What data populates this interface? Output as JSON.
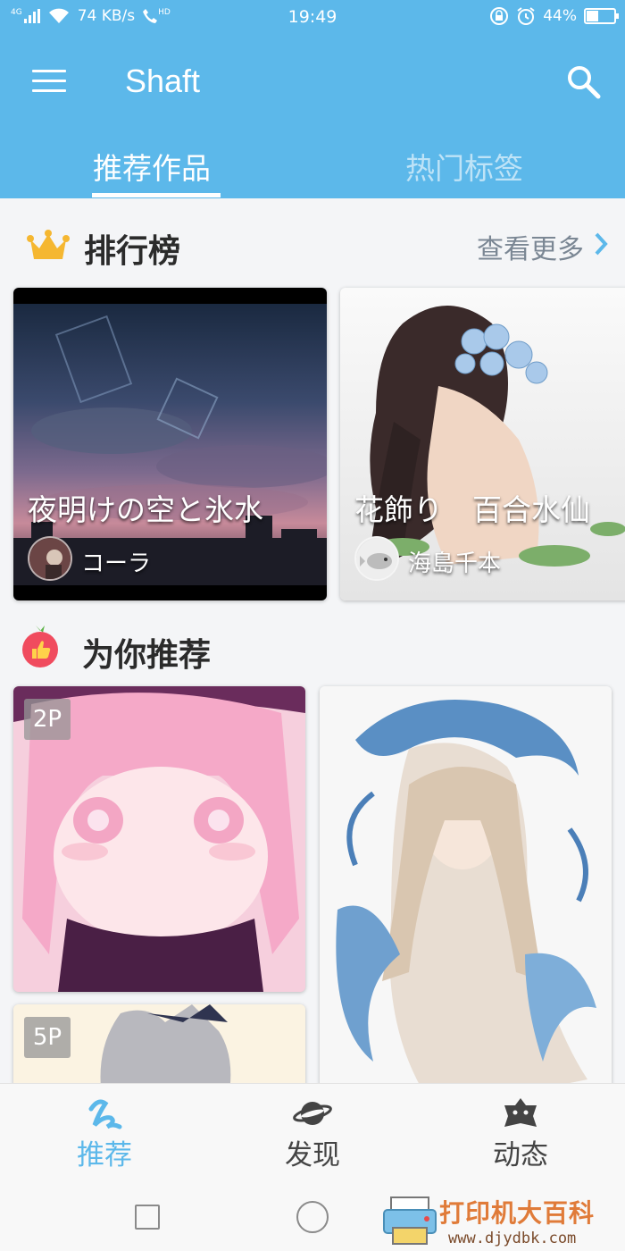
{
  "status_bar": {
    "network": "4G",
    "speed": "74 KB/s",
    "hd": "HD",
    "time": "19:49",
    "battery": "44%",
    "battery_level": 0.44
  },
  "app_bar": {
    "title": "Shaft",
    "menu_icon": "menu-icon",
    "search_icon": "search-icon"
  },
  "tabs": [
    {
      "label": "推荐作品",
      "active": true
    },
    {
      "label": "热门标签",
      "active": false
    }
  ],
  "ranking": {
    "title": "排行榜",
    "more_label": "查看更多",
    "items": [
      {
        "title": "夜明けの空と氷水",
        "author": "コーラ"
      },
      {
        "title": "花飾り　百合水仙",
        "author": "海島千本"
      }
    ]
  },
  "recommend": {
    "title": "为你推荐",
    "items": [
      {
        "pages": "2P"
      },
      {
        "pages": ""
      },
      {
        "pages": "5P"
      }
    ]
  },
  "bottom_nav": [
    {
      "label": "推荐",
      "icon": "recommend-icon",
      "active": true
    },
    {
      "label": "发现",
      "icon": "planet-icon",
      "active": false
    },
    {
      "label": "动态",
      "icon": "star-face-icon",
      "active": false
    }
  ],
  "watermark": {
    "text": "打印机大百科",
    "url": "www.djydbk.com"
  },
  "colors": {
    "accent": "#5cb8ea",
    "background": "#f4f5f7"
  }
}
